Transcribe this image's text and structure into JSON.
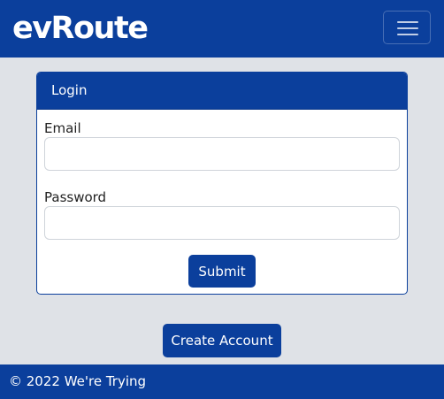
{
  "navbar": {
    "brand": "evRoute",
    "brand_icon": "map-pin-icon",
    "menu_icon": "hamburger-menu-icon"
  },
  "login": {
    "title": "Login",
    "email_label": "Email",
    "email_value": "",
    "password_label": "Password",
    "password_value": "",
    "submit_label": "Submit"
  },
  "create_account_label": "Create Account",
  "footer": {
    "text": "© 2022 We're Trying"
  },
  "colors": {
    "primary": "#0b3f9c",
    "background": "#dfe2e7",
    "card": "#ffffff"
  }
}
